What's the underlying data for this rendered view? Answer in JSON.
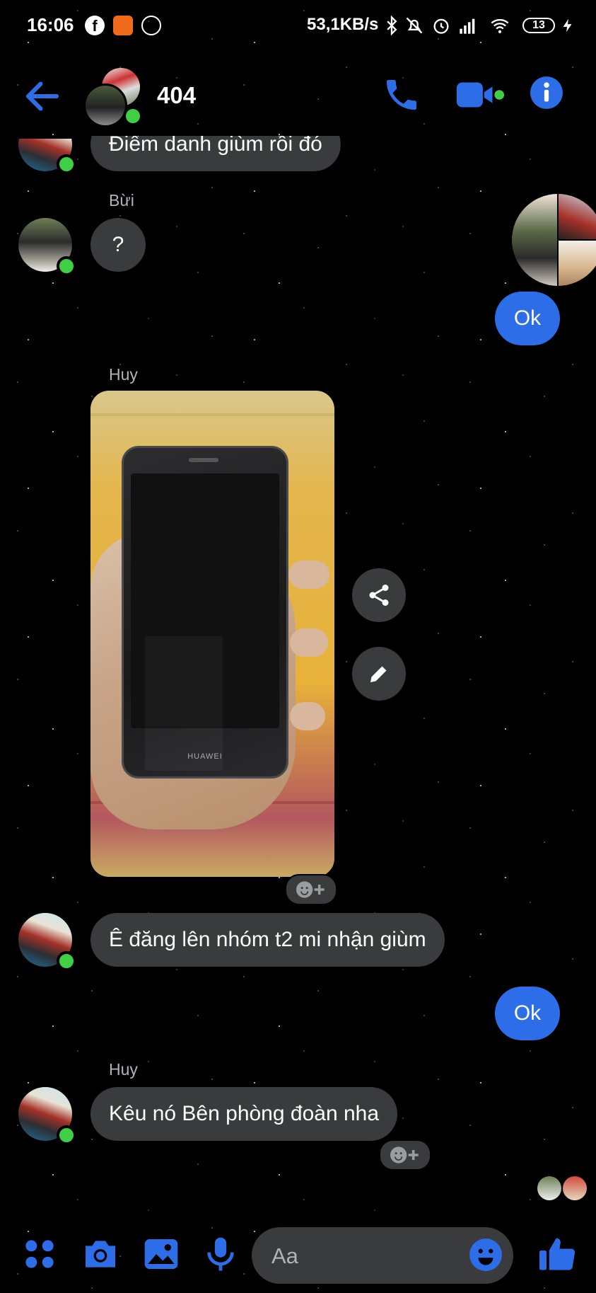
{
  "status_bar": {
    "time": "16:06",
    "network_speed": "53,1KB/s",
    "battery_level": "13",
    "icons": [
      "facebook-icon",
      "mi-store-icon",
      "messenger-icon",
      "bluetooth-icon",
      "mute-icon",
      "alarm-icon",
      "signal-icon",
      "wifi-icon",
      "battery-icon",
      "charging-icon"
    ]
  },
  "header": {
    "title": "404",
    "icons": [
      "back-arrow-icon",
      "phone-call-icon",
      "video-call-icon",
      "info-icon"
    ],
    "accent_color": "#2d6ee8",
    "online_color": "#3fce46"
  },
  "messages": [
    {
      "sender": "",
      "text": "Điểm danh giùm rồi đó",
      "direction": "in"
    },
    {
      "sender": "Bừi",
      "text": "?",
      "direction": "in"
    },
    {
      "sender": "",
      "text": "Ok",
      "direction": "out"
    },
    {
      "sender": "Huy",
      "text": "",
      "type": "photo",
      "photo_brand": "HUAWEI",
      "direction": "in"
    },
    {
      "sender": "",
      "text": "Ê đăng lên nhóm t2 mi nhận giùm",
      "direction": "in"
    },
    {
      "sender": "",
      "text": "Ok",
      "direction": "out"
    },
    {
      "sender": "Huy",
      "text": "Kêu nó Bên phòng đoàn nha",
      "direction": "in"
    }
  ],
  "photo_actions": [
    "share-icon",
    "edit-icon"
  ],
  "composer": {
    "placeholder": "Aa",
    "icons": [
      "menu-dots-icon",
      "camera-icon",
      "gallery-icon",
      "microphone-icon",
      "emoji-icon",
      "thumbs-up-icon"
    ]
  }
}
